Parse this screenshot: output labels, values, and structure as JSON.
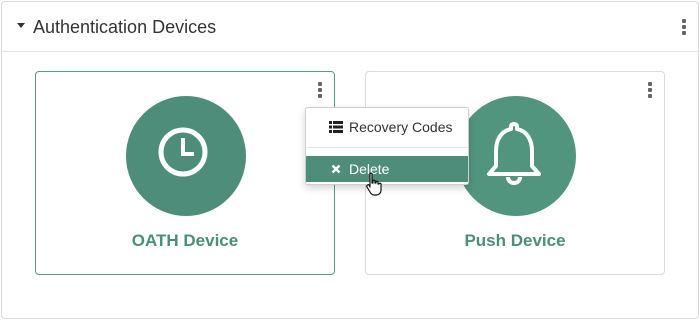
{
  "panel": {
    "title": "Authentication Devices",
    "icons": {
      "collapse": "caret-down-icon",
      "more": "kebab-icon"
    }
  },
  "devices": [
    {
      "label": "OATH Device",
      "icon": "clock-icon",
      "selected": true
    },
    {
      "label": "Push Device",
      "icon": "bell-icon",
      "selected": false
    }
  ],
  "context_menu": {
    "items": [
      {
        "label": "Recovery Codes",
        "icon": "list-icon"
      },
      {
        "label": "Delete",
        "icon": "close-icon",
        "highlighted": true
      }
    ]
  },
  "colors": {
    "accent": "#4e8d7a",
    "label": "#4b8f7a",
    "selected_border": "#5a9a86"
  }
}
